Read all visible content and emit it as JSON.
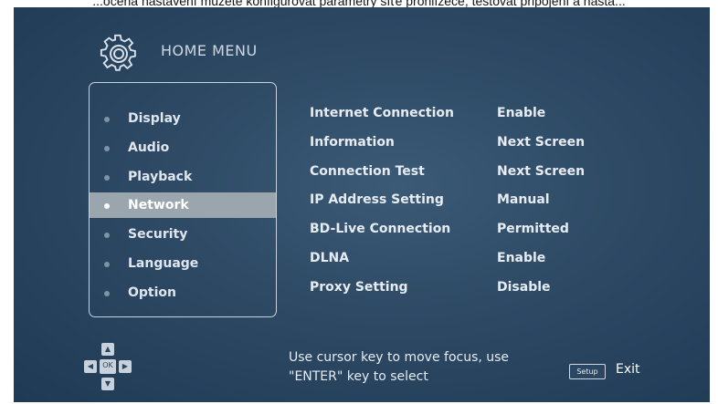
{
  "caption": "...očená nastavení můžete konfigurovat parametry síťe prohlížeče, testovat připojení a nasta...",
  "header": {
    "title": "HOME MENU",
    "logo_icon": "gear-icon"
  },
  "menu": {
    "items": [
      {
        "label": "Display"
      },
      {
        "label": "Audio"
      },
      {
        "label": "Playback"
      },
      {
        "label": "Network"
      },
      {
        "label": "Security"
      },
      {
        "label": "Language"
      },
      {
        "label": "Option"
      }
    ],
    "active": "Network"
  },
  "settings": [
    {
      "name": "Internet Connection",
      "value": "Enable"
    },
    {
      "name": "Information",
      "value": "Next Screen"
    },
    {
      "name": "Connection Test",
      "value": "Next Screen"
    },
    {
      "name": "IP Address Setting",
      "value": "Manual"
    },
    {
      "name": "BD-Live Connection",
      "value": "Permitted"
    },
    {
      "name": "DLNA",
      "value": "Enable"
    },
    {
      "name": "Proxy Setting",
      "value": "Disable"
    }
  ],
  "footer": {
    "dpad_center": "OK",
    "hint_line1": "Use cursor key to move focus, use",
    "hint_line2": "\"ENTER\" key to select",
    "setup_label": "Setup",
    "exit_label": "Exit"
  },
  "colors": {
    "background": "#2d4964",
    "highlight": "#9ba5ad",
    "text": "#e6ecf2"
  }
}
